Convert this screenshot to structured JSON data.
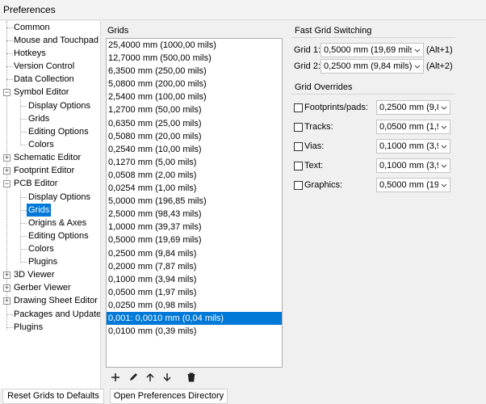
{
  "window": {
    "title": "Preferences"
  },
  "tree": {
    "items": [
      {
        "label": "Common"
      },
      {
        "label": "Mouse and Touchpad"
      },
      {
        "label": "Hotkeys"
      },
      {
        "label": "Version Control"
      },
      {
        "label": "Data Collection"
      },
      {
        "label": "Symbol Editor"
      },
      {
        "label": "Display Options"
      },
      {
        "label": "Grids"
      },
      {
        "label": "Editing Options"
      },
      {
        "label": "Colors"
      },
      {
        "label": "Schematic Editor"
      },
      {
        "label": "Footprint Editor"
      },
      {
        "label": "PCB Editor"
      },
      {
        "label": "Display Options"
      },
      {
        "label": "Grids"
      },
      {
        "label": "Origins & Axes"
      },
      {
        "label": "Editing Options"
      },
      {
        "label": "Colors"
      },
      {
        "label": "Plugins"
      },
      {
        "label": "3D Viewer"
      },
      {
        "label": "Gerber Viewer"
      },
      {
        "label": "Drawing Sheet Editor"
      },
      {
        "label": "Packages and Updates"
      },
      {
        "label": "Plugins"
      }
    ],
    "selected": "Grids"
  },
  "grids": {
    "label": "Grids",
    "items": [
      "25,4000 mm (1000,00 mils)",
      "12,7000 mm (500,00 mils)",
      "6,3500 mm (250,00 mils)",
      "5,0800 mm (200,00 mils)",
      "2,5400 mm (100,00 mils)",
      "1,2700 mm (50,00 mils)",
      "0,6350 mm (25,00 mils)",
      "0,5080 mm (20,00 mils)",
      "0,2540 mm (10,00 mils)",
      "0,1270 mm (5,00 mils)",
      "0,0508 mm (2,00 mils)",
      "0,0254 mm (1,00 mils)",
      "5,0000 mm (196,85 mils)",
      "2,5000 mm (98,43 mils)",
      "1,0000 mm (39,37 mils)",
      "0,5000 mm (19,69 mils)",
      "0,2500 mm (9,84 mils)",
      "0,2000 mm (7,87 mils)",
      "0,1000 mm (3,94 mils)",
      "0,0500 mm (1,97 mils)",
      "0,0250 mm (0,98 mils)",
      "0,001: 0,0010 mm (0,04 mils)",
      "0,0100 mm (0,39 mils)"
    ],
    "selected_index": 21,
    "toolbar": [
      "add-icon",
      "edit-icon",
      "move-up-icon",
      "move-down-icon",
      "delete-icon"
    ]
  },
  "fast_grid": {
    "title": "Fast Grid Switching",
    "grid1_label": "Grid 1:",
    "grid1_value": "0,5000 mm (19,69 mils",
    "grid1_hotkey": "(Alt+1)",
    "grid2_label": "Grid 2:",
    "grid2_value": "0,2500 mm (9,84 mils)",
    "grid2_hotkey": "(Alt+2)"
  },
  "overrides": {
    "title": "Grid Overrides",
    "items": [
      {
        "label": "Footprints/pads:",
        "value": "0,2500 mm (9,8",
        "checked": false
      },
      {
        "label": "Tracks:",
        "value": "0,0500 mm (1,9",
        "checked": false
      },
      {
        "label": "Vias:",
        "value": "0,1000 mm (3,9",
        "checked": false
      },
      {
        "label": "Text:",
        "value": "0,1000 mm (3,9",
        "checked": false
      },
      {
        "label": "Graphics:",
        "value": "0,5000 mm (19,",
        "checked": false
      }
    ]
  },
  "buttons": {
    "reset": "Reset Grids to Defaults",
    "open_dir": "Open Preferences Directory"
  },
  "colors": {
    "selection": "#0078d7",
    "background": "#f0f0f0"
  }
}
